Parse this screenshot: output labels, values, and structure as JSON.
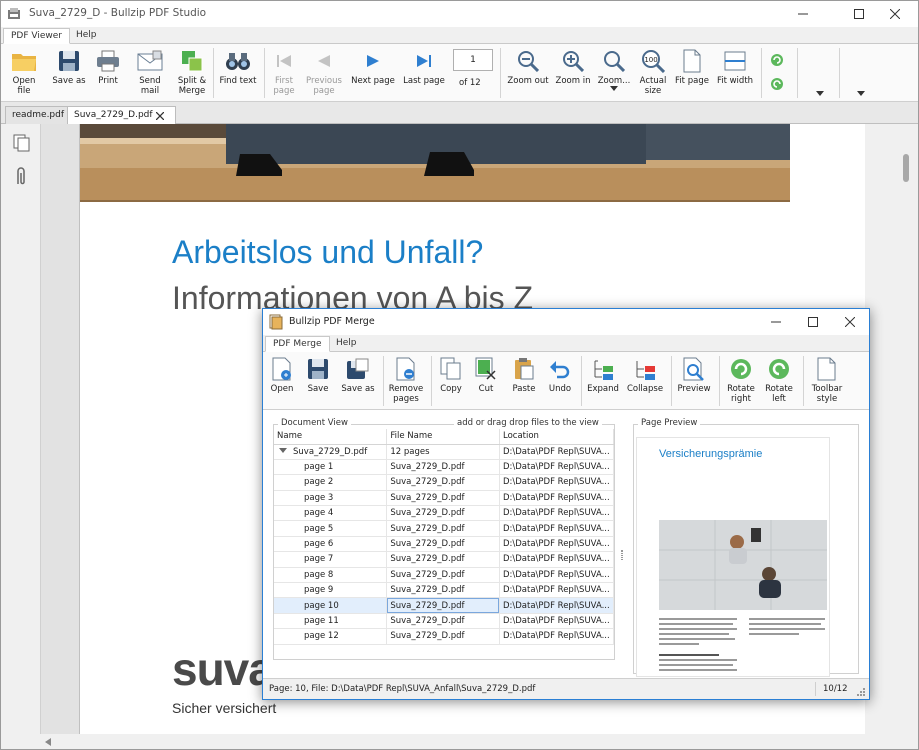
{
  "window": {
    "title": "Suva_2729_D - Bullzip PDF Studio"
  },
  "ribbon_tabs": [
    "PDF Viewer",
    "Help"
  ],
  "toolbar": {
    "open_file": "Open file",
    "save_as": "Save as",
    "print": "Print",
    "send_mail": "Send mail",
    "split_merge": [
      "Split &",
      "Merge"
    ],
    "find_text": "Find text",
    "first_page": [
      "First",
      "page"
    ],
    "previous_page": [
      "Previous",
      "page"
    ],
    "next_page": "Next page",
    "last_page": "Last page",
    "page_number": "1",
    "page_of": "of 12",
    "zoom_out": "Zoom out",
    "zoom_in": "Zoom in",
    "zoom_menu": "Zoom...",
    "actual_size": [
      "Actual",
      "size"
    ],
    "fit_page": "Fit page",
    "fit_width": "Fit width",
    "actual_icon_text": "100"
  },
  "doc_tabs": [
    {
      "label": "readme.pdf"
    },
    {
      "label": "Suva_2729_D.pdf"
    }
  ],
  "page": {
    "heading1": "Arbeitslos und Unfall?",
    "heading2": "Informationen von A bis Z",
    "logo": "suva",
    "tagline": "Sicher versichert"
  },
  "merge": {
    "title": "Bullzip PDF Merge",
    "tabs": [
      "PDF Merge",
      "Help"
    ],
    "toolbar": {
      "open": "Open",
      "save": "Save",
      "save_as": "Save as",
      "remove_pages": [
        "Remove",
        "pages"
      ],
      "copy": "Copy",
      "cut": "Cut",
      "paste": "Paste",
      "undo": "Undo",
      "expand": "Expand",
      "collapse": "Collapse",
      "preview": "Preview",
      "rotate_right": [
        "Rotate",
        "right"
      ],
      "rotate_left": [
        "Rotate",
        "left"
      ],
      "toolbar_style": [
        "Toolbar",
        "style"
      ]
    },
    "document_view_label": "Document View",
    "drop_hint": "add or drag drop files to the view",
    "columns": [
      "Name",
      "File Name",
      "Location"
    ],
    "root_row": {
      "name": "Suva_2729_D.pdf",
      "file": "12 pages",
      "location": "D:\\Data\\PDF Repl\\SUVA..."
    },
    "rows": [
      {
        "name": "page 1",
        "file": "Suva_2729_D.pdf",
        "location": "D:\\Data\\PDF Repl\\SUVA..."
      },
      {
        "name": "page 2",
        "file": "Suva_2729_D.pdf",
        "location": "D:\\Data\\PDF Repl\\SUVA..."
      },
      {
        "name": "page 3",
        "file": "Suva_2729_D.pdf",
        "location": "D:\\Data\\PDF Repl\\SUVA..."
      },
      {
        "name": "page 4",
        "file": "Suva_2729_D.pdf",
        "location": "D:\\Data\\PDF Repl\\SUVA..."
      },
      {
        "name": "page 5",
        "file": "Suva_2729_D.pdf",
        "location": "D:\\Data\\PDF Repl\\SUVA..."
      },
      {
        "name": "page 6",
        "file": "Suva_2729_D.pdf",
        "location": "D:\\Data\\PDF Repl\\SUVA..."
      },
      {
        "name": "page 7",
        "file": "Suva_2729_D.pdf",
        "location": "D:\\Data\\PDF Repl\\SUVA..."
      },
      {
        "name": "page 8",
        "file": "Suva_2729_D.pdf",
        "location": "D:\\Data\\PDF Repl\\SUVA..."
      },
      {
        "name": "page 9",
        "file": "Suva_2729_D.pdf",
        "location": "D:\\Data\\PDF Repl\\SUVA..."
      },
      {
        "name": "page 10",
        "file": "Suva_2729_D.pdf",
        "location": "D:\\Data\\PDF Repl\\SUVA...",
        "selected": true
      },
      {
        "name": "page 11",
        "file": "Suva_2729_D.pdf",
        "location": "D:\\Data\\PDF Repl\\SUVA..."
      },
      {
        "name": "page 12",
        "file": "Suva_2729_D.pdf",
        "location": "D:\\Data\\PDF Repl\\SUVA..."
      }
    ],
    "page_preview_label": "Page Preview",
    "preview_title": "Versicherungsprämie",
    "status_left": "Page: 10, File: D:\\Data\\PDF Repl\\SUVA_Anfall\\Suva_2729_D.pdf",
    "status_right": "10/12"
  },
  "colors": {
    "accent": "#1b7fc7",
    "dialog_border": "#2a7fd4",
    "selection": "#e2eefc"
  }
}
